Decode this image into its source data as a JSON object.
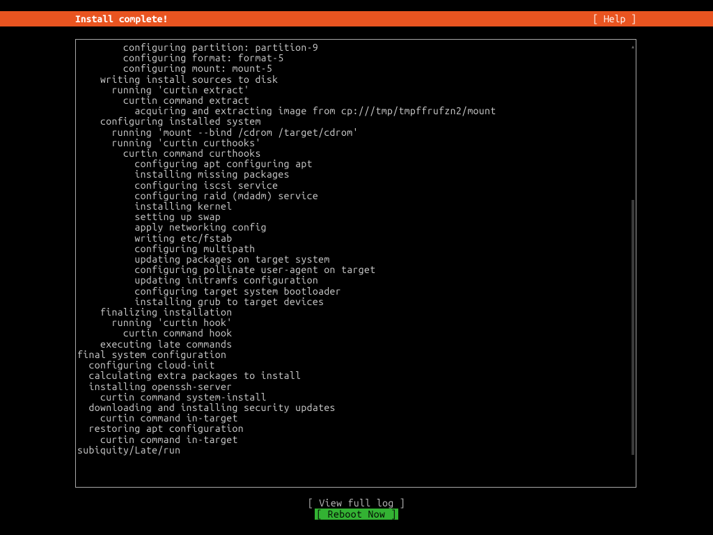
{
  "header": {
    "title": "Install complete!",
    "help": "[ Help ]"
  },
  "log": {
    "lines": [
      "        configuring partition: partition-9",
      "        configuring format: format-5",
      "        configuring mount: mount-5",
      "    writing install sources to disk",
      "      running 'curtin extract'",
      "        curtin command extract",
      "          acquiring and extracting image from cp:///tmp/tmpffrufzn2/mount",
      "    configuring installed system",
      "      running 'mount --bind /cdrom /target/cdrom'",
      "      running 'curtin curthooks'",
      "        curtin command curthooks",
      "          configuring apt configuring apt",
      "          installing missing packages",
      "          configuring iscsi service",
      "          configuring raid (mdadm) service",
      "          installing kernel",
      "          setting up swap",
      "          apply networking config",
      "          writing etc/fstab",
      "          configuring multipath",
      "          updating packages on target system",
      "          configuring pollinate user-agent on target",
      "          updating initramfs configuration",
      "          configuring target system bootloader",
      "          installing grub to target devices",
      "    finalizing installation",
      "      running 'curtin hook'",
      "        curtin command hook",
      "    executing late commands",
      "final system configuration",
      "  configuring cloud-init",
      "  calculating extra packages to install",
      "  installing openssh-server",
      "    curtin command system-install",
      "  downloading and installing security updates",
      "    curtin command in-target",
      "  restoring apt configuration",
      "    curtin command in-target",
      "subiquity/Late/run"
    ]
  },
  "footer": {
    "view_log": "[ View full log ]",
    "reboot": "[ Reboot Now     ]"
  }
}
